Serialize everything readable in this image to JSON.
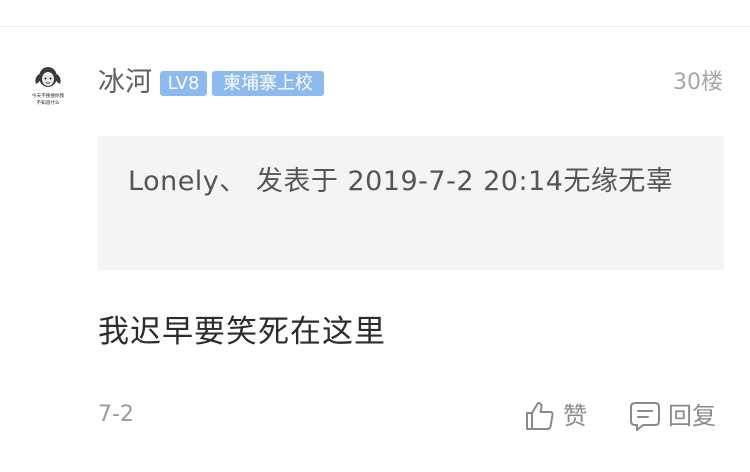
{
  "post": {
    "username": "冰河",
    "level_badge": "LV8",
    "title_badge": "柬埔寨上校",
    "floor": "30楼",
    "avatar_caption_top": "今天不搜搜你我",
    "avatar_caption_bottom": "不知道什么",
    "quote": "Lonely、 发表于 2019-7-2 20:14无缘无辜",
    "body": "我迟早要笑死在这里",
    "date": "7-2"
  },
  "actions": {
    "like_label": "赞",
    "reply_label": "回复"
  },
  "colors": {
    "badge": "#8bb9f0",
    "quote_bg": "#f4f4f5",
    "muted": "#9a9a9a"
  },
  "icons": {
    "like": "thumbs-up-icon",
    "reply": "speech-bubble-icon"
  }
}
